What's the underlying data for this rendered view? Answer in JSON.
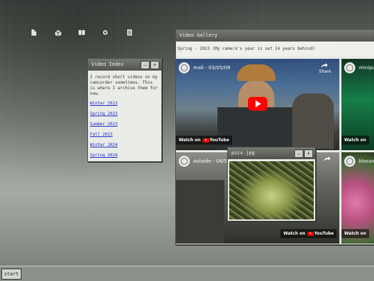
{
  "desktop": {
    "icons": [
      {
        "name": "document-icon"
      },
      {
        "name": "package-icon"
      },
      {
        "name": "book-icon"
      },
      {
        "name": "settings-icon"
      },
      {
        "name": "archive-icon"
      }
    ]
  },
  "video_index": {
    "title": "Video Index",
    "min": "–",
    "max": "+",
    "intro": "I record short videos on my camcorder sometimes. This is where I archive them for now.",
    "links": [
      "Winter 2023",
      "Spring 2023",
      "Summer 2023",
      "Fall 2023",
      "Winter 2024",
      "Spring 2024"
    ]
  },
  "gallery": {
    "title": "Video Gallery",
    "subtitle": "Spring - 2023 (My camera's year is set 14 years behind)",
    "videos": [
      {
        "title": "mall - 03/05/09",
        "share": "Share",
        "watch": "Watch on",
        "brand": "YouTube"
      },
      {
        "title": "minipu",
        "watch": "Watch on",
        "brand": "YouTube"
      },
      {
        "title": "outside - 04/5",
        "watch": "Watch on",
        "brand": "YouTube"
      },
      {
        "title": "blosso",
        "watch": "Watch on",
        "brand": "YouTube"
      }
    ]
  },
  "pics": {
    "title": "pics.jpg",
    "min": "–",
    "max": "+"
  },
  "taskbar": {
    "start_label": "start"
  }
}
